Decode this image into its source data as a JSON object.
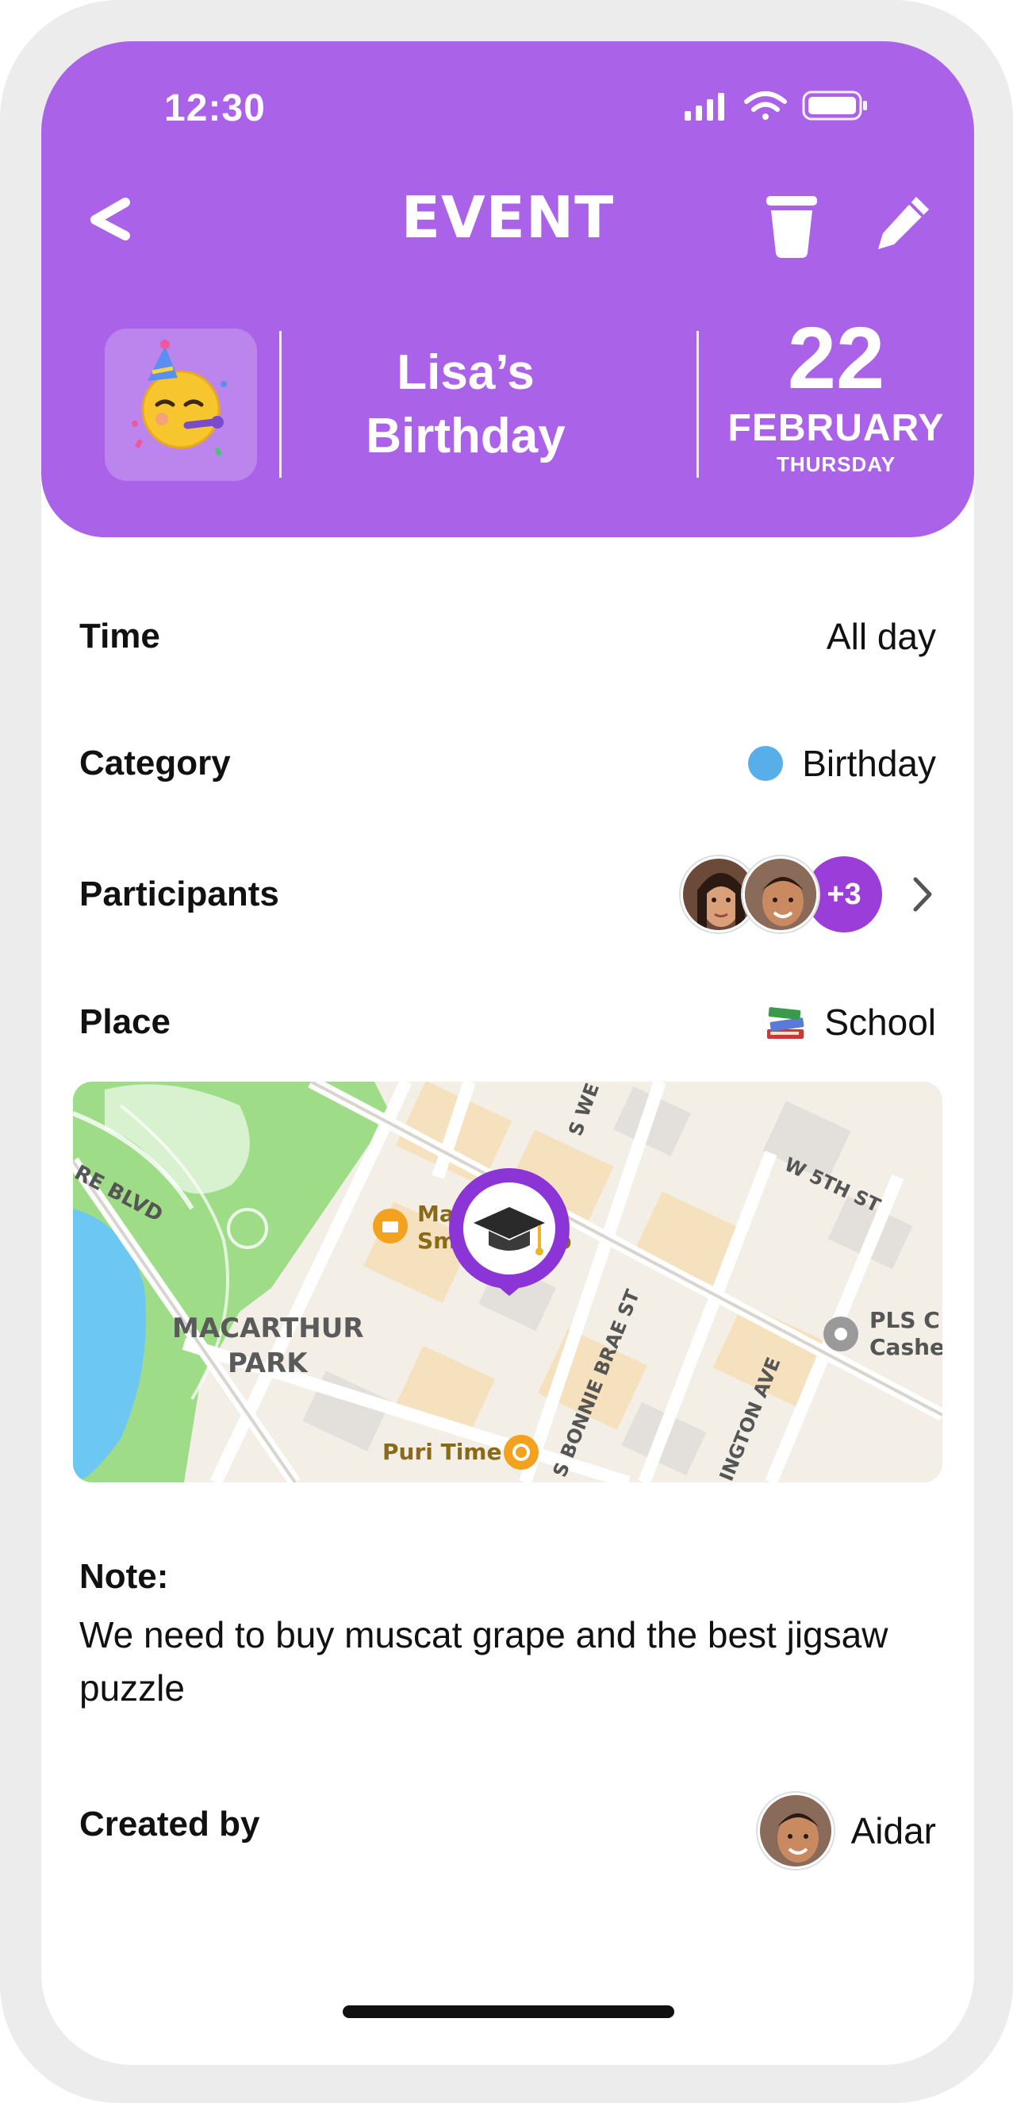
{
  "status_bar": {
    "time": "12:30"
  },
  "nav": {
    "title": "EVENT"
  },
  "event": {
    "emoji": "🥳",
    "name_line1": "Lisa’s",
    "name_line2": "Birthday",
    "day": "22",
    "month": "FEBRUARY",
    "weekday": "THURSDAY"
  },
  "details": {
    "time_label": "Time",
    "time_value": "All day",
    "category_label": "Category",
    "category_value": "Birthday",
    "category_color": "#57aee9",
    "participants_label": "Participants",
    "participants_more": "+3",
    "place_label": "Place",
    "place_icon": "📚",
    "place_value": "School"
  },
  "map": {
    "labels": {
      "boulevard": "RE BLVD",
      "park_line1": "MACARTHUR",
      "park_line2": "PARK",
      "poi1_line1": "Mac Park",
      "poi1_line2": "Smoke Shop",
      "poi2": "Puri Time",
      "poi3_line1": "PLS C",
      "poi3_line2": "Cashe",
      "street1": "S WE",
      "street2": "W 5TH ST",
      "street3": "S BONNIE BRAE ST",
      "street4": "INGTON AVE"
    },
    "pin_icon": "🎓"
  },
  "note": {
    "label": "Note:",
    "text": "We need to buy muscat grape and the best jigsaw puzzle"
  },
  "creator": {
    "label": "Created by",
    "name": "Aidar"
  },
  "colors": {
    "accent": "#a962e8",
    "badge": "#9b3ed9"
  }
}
